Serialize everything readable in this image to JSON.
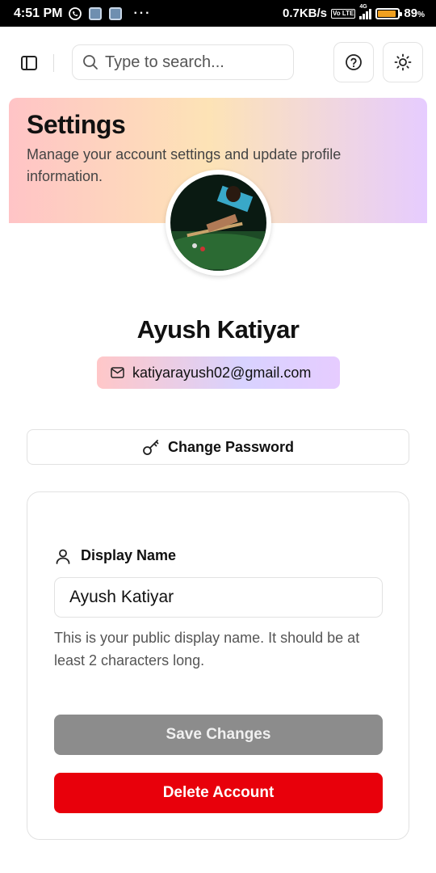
{
  "status_bar": {
    "time": "4:51 PM",
    "more": "···",
    "net_speed": "0.7KB/s",
    "volte": "Vo LTE",
    "net_type": "4G",
    "battery": "89",
    "battery_pct_sign": "%",
    "battery_level": 0.89
  },
  "header": {
    "search_placeholder": "Type to search..."
  },
  "banner": {
    "title": "Settings",
    "subtitle": "Manage your account settings and update profile information."
  },
  "profile": {
    "name": "Ayush Katiyar",
    "email": "katiyarayush02@gmail.com"
  },
  "actions": {
    "change_password": "Change Password"
  },
  "form": {
    "display_name_label": "Display Name",
    "display_name_value": "Ayush Katiyar",
    "help_text": "This is your public display name. It should be at least 2 characters long.",
    "save_label": "Save Changes",
    "delete_label": "Delete Account"
  },
  "colors": {
    "save_button": "#8c8c8c",
    "delete_button": "#e8000b",
    "banner_gradient": [
      "#ffc4c6",
      "#fde3b6",
      "#e6ccff"
    ]
  },
  "icons": {
    "status": [
      "whatsapp-icon",
      "notification-icon",
      "signal-icon",
      "battery-icon"
    ],
    "header": [
      "sidebar-toggle-icon",
      "search-icon",
      "help-icon",
      "sun-icon"
    ],
    "body": [
      "mail-icon",
      "key-icon",
      "user-icon"
    ]
  }
}
